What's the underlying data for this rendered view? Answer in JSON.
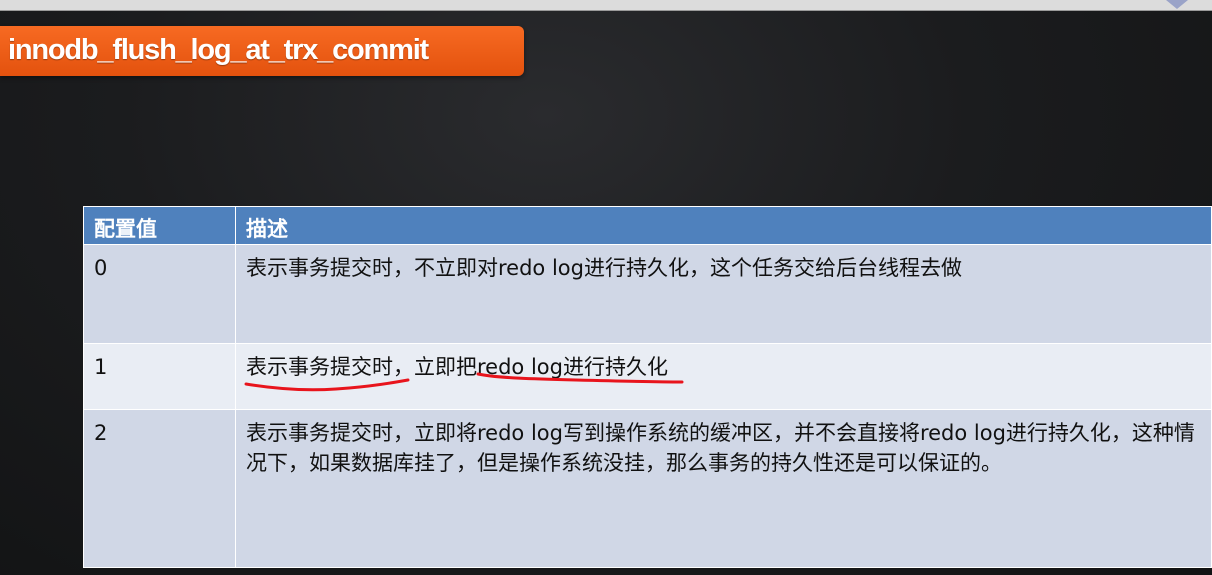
{
  "slide": {
    "title": "innodb_flush_log_at_trx_commit",
    "accent_color": "#ee5a16",
    "header_color": "#4f81bd"
  },
  "table": {
    "headers": [
      "配置值",
      "描述"
    ],
    "rows": [
      {
        "value": "0",
        "description": "表示事务提交时，不立即对redo log进行持久化，这个任务交给后台线程去做"
      },
      {
        "value": "1",
        "description": "表示事务提交时，立即把redo log进行持久化"
      },
      {
        "value": "2",
        "description": "表示事务提交时，立即将redo log写到操作系统的缓冲区，并不会直接将redo log进行持久化，这种情况下，如果数据库挂了，但是操作系统没挂，那么事务的持久性还是可以保证的。"
      }
    ]
  },
  "annotation": {
    "color": "#e8141c"
  }
}
